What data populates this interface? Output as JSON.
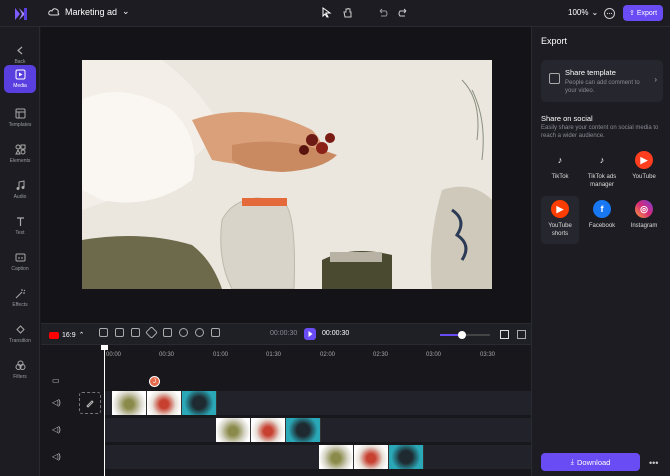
{
  "header": {
    "project_title": "Marketing ad",
    "zoom": "100%",
    "export_label": "Export"
  },
  "sidebar": {
    "items": [
      {
        "label": "Back",
        "icon": "chevron-left-icon"
      },
      {
        "label": "Media",
        "icon": "media-icon",
        "active": true
      },
      {
        "label": "Templates",
        "icon": "templates-icon"
      },
      {
        "label": "Elements",
        "icon": "elements-icon"
      },
      {
        "label": "Audio",
        "icon": "music-icon"
      },
      {
        "label": "Text",
        "icon": "text-icon"
      },
      {
        "label": "Caption",
        "icon": "caption-icon"
      },
      {
        "label": "Effects",
        "icon": "effects-icon"
      },
      {
        "label": "Transition",
        "icon": "transition-icon"
      },
      {
        "label": "Filters",
        "icon": "filters-icon"
      }
    ]
  },
  "timeline": {
    "aspect": "16:9",
    "current_time": "00:00:30",
    "total_time": "00:00:30",
    "ruler": [
      "00:00",
      "00:30",
      "01:00",
      "01:30",
      "02:00",
      "02:30",
      "03:00",
      "03:30"
    ],
    "avatar_initial": "J"
  },
  "panel": {
    "title": "Export",
    "share_template": {
      "title": "Share template",
      "subtitle": "People can add comment to your video."
    },
    "social_title": "Share on social",
    "social_subtitle": "Easily share your content on social media to reach a wider audience.",
    "socials": [
      {
        "label": "TikTok",
        "color": "#111111"
      },
      {
        "label": "TikTok ads manager",
        "color": "#111111"
      },
      {
        "label": "YouTube",
        "color": "#ff0000"
      },
      {
        "label": "YouTube shorts",
        "color": "#ff3d00"
      },
      {
        "label": "Facebook",
        "color": "#1877f2"
      },
      {
        "label": "Instagram",
        "color": "#d62976"
      }
    ],
    "download_label": "Download"
  },
  "colors": {
    "accent": "#6a4cf5"
  }
}
